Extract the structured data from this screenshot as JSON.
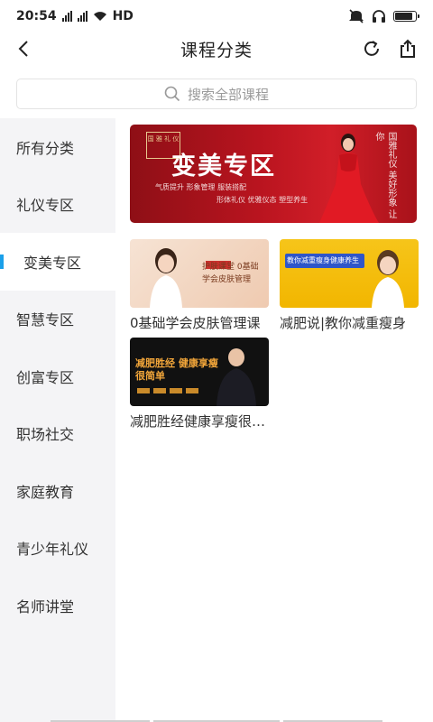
{
  "status_bar": {
    "time": "20:54",
    "network": "HD"
  },
  "nav": {
    "title": "课程分类"
  },
  "search": {
    "placeholder": "搜索全部课程"
  },
  "sidebar": {
    "items": [
      {
        "label": "所有分类",
        "active": false
      },
      {
        "label": "礼仪专区",
        "active": false
      },
      {
        "label": "变美专区",
        "active": true
      },
      {
        "label": "智慧专区",
        "active": false
      },
      {
        "label": "创富专区",
        "active": false
      },
      {
        "label": "职场社交",
        "active": false
      },
      {
        "label": "家庭教育",
        "active": false
      },
      {
        "label": "青少年礼仪",
        "active": false
      },
      {
        "label": "名师讲堂",
        "active": false
      }
    ]
  },
  "banner": {
    "title": "变美专区",
    "logo_text": "国 雅 礼 仪",
    "sub_line1": "气质提升  形象管理  服装搭配",
    "sub_line2": "形体礼仪  优雅仪态  塑型养生",
    "side_text": "国雅礼仪 美好形象 让你"
  },
  "courses": [
    {
      "title": "0基础学会皮肤管理课",
      "image_text": "护肤课堂  0基础 学会皮肤管理"
    },
    {
      "title": "减肥说|教你减重瘦身",
      "image_text": "教你减重瘦身健康养生"
    },
    {
      "title": "减肥胜经健康享瘦很简单",
      "image_text": "减肥胜经 健康享瘦很简单"
    }
  ],
  "colors": {
    "accent": "#1aa0ea",
    "banner_red": "#b9141f",
    "sidebar_bg": "#f4f4f6"
  }
}
